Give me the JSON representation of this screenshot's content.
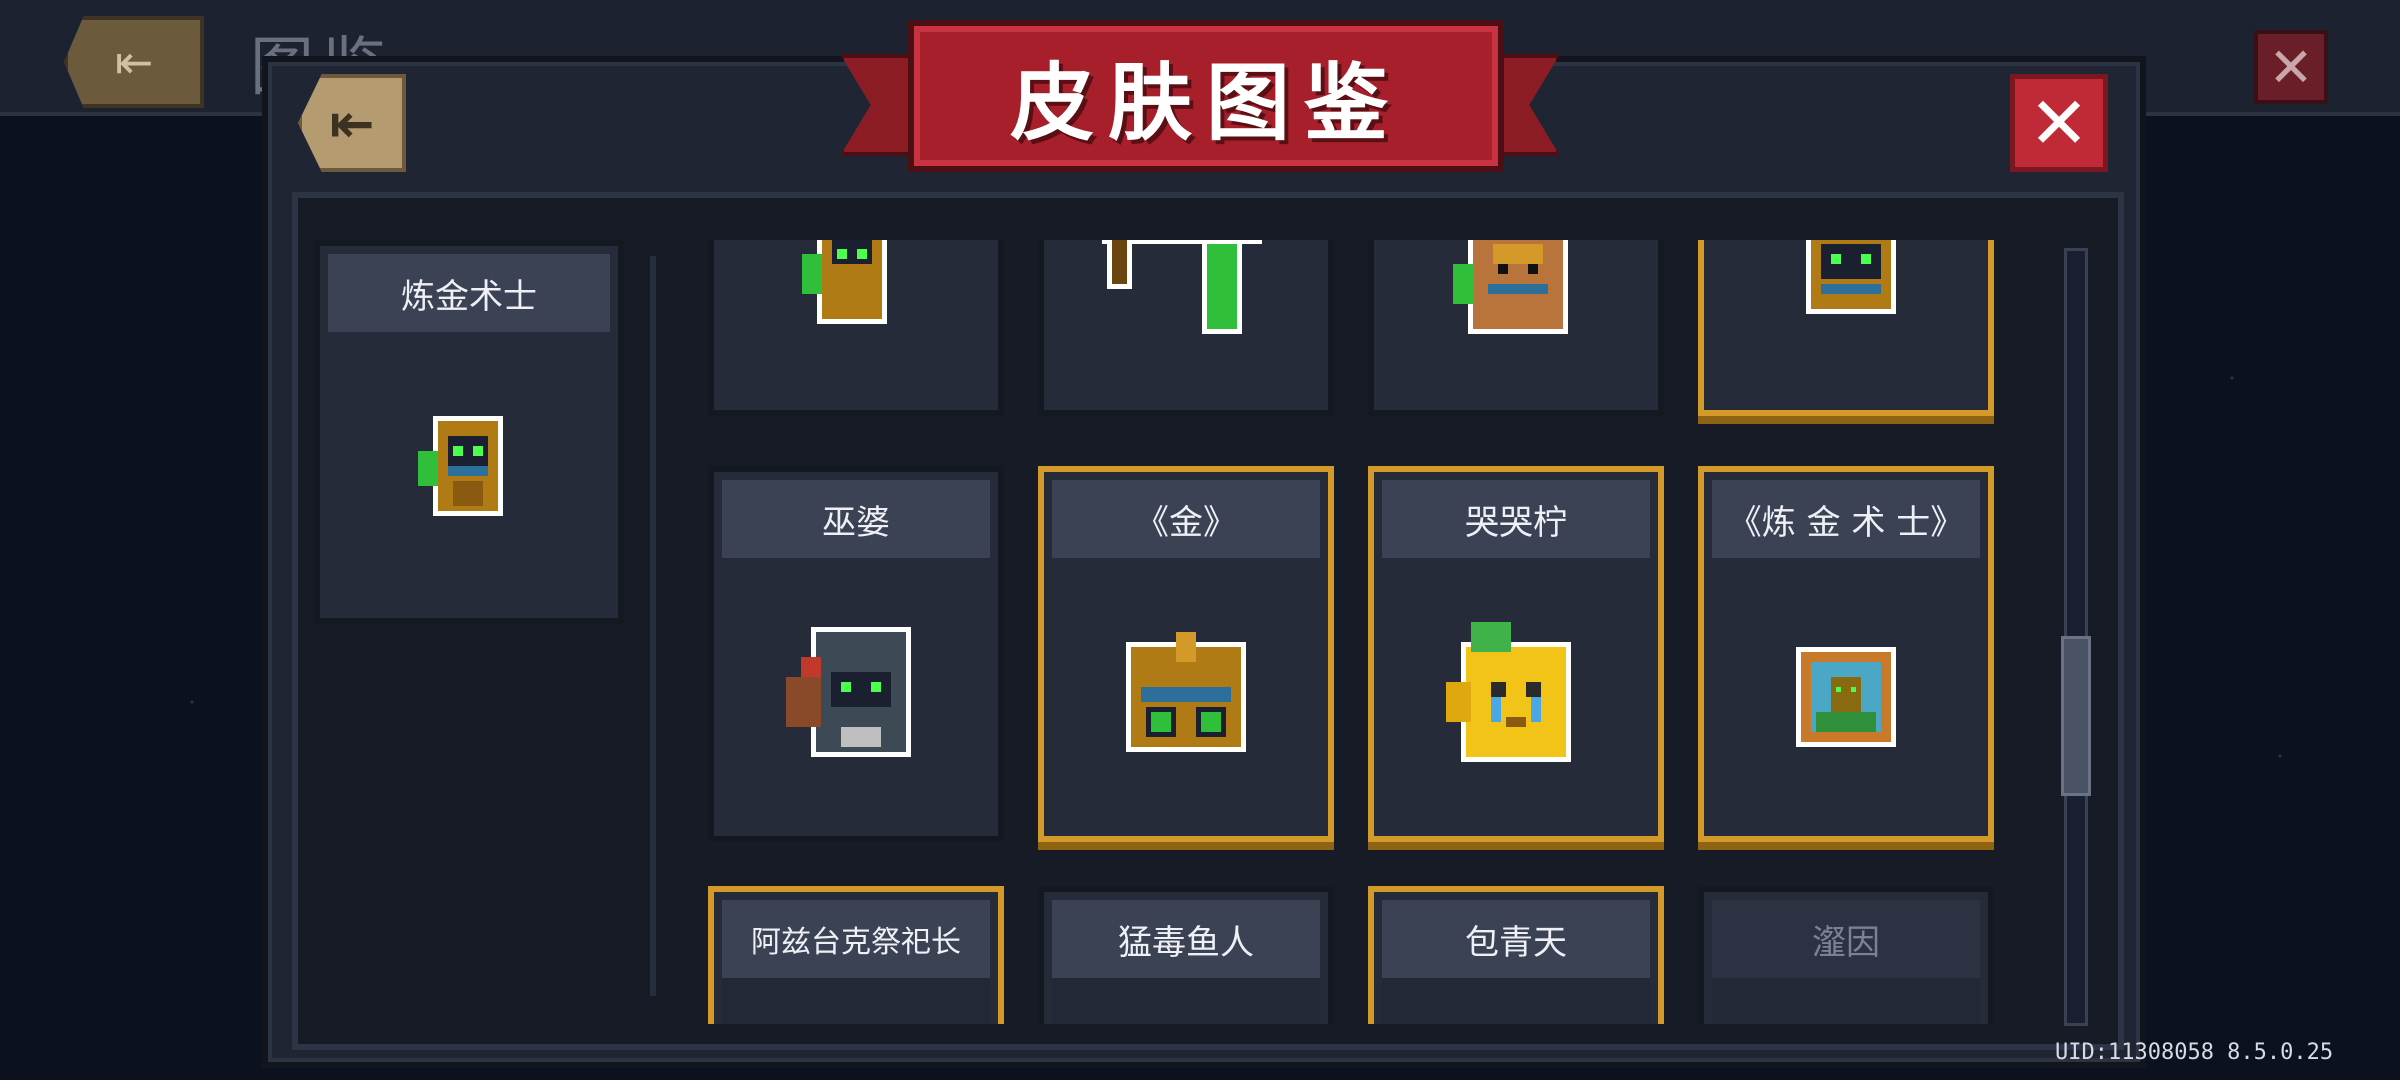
{
  "background": {
    "title": "图鉴"
  },
  "modal": {
    "title": "皮肤图鉴",
    "back_glyph": "⇤",
    "close_glyph": "✕"
  },
  "character": {
    "name": "炼金术士"
  },
  "skins": [
    {
      "label": "",
      "gold": false
    },
    {
      "label": "",
      "gold": false
    },
    {
      "label": "",
      "gold": false
    },
    {
      "label": "",
      "gold": true
    },
    {
      "label": "巫婆",
      "gold": false
    },
    {
      "label": "《金》",
      "gold": true
    },
    {
      "label": "哭哭柠",
      "gold": true
    },
    {
      "label": "《炼 金 术 士》",
      "gold": true
    },
    {
      "label": "阿兹台克祭祀长",
      "gold": true
    },
    {
      "label": "猛毒鱼人",
      "gold": false
    },
    {
      "label": "包青天",
      "gold": true
    },
    {
      "label": "瀣因",
      "gold": false,
      "dim": true
    }
  ],
  "scroll": {
    "position_fraction": 0.48
  },
  "uid_text": "UID:11308058 8.5.0.25",
  "colors": {
    "gold_border": "#d39a2a",
    "banner_red": "#a61f2a",
    "close_red": "#c02a36",
    "panel_bg": "#252b39"
  }
}
